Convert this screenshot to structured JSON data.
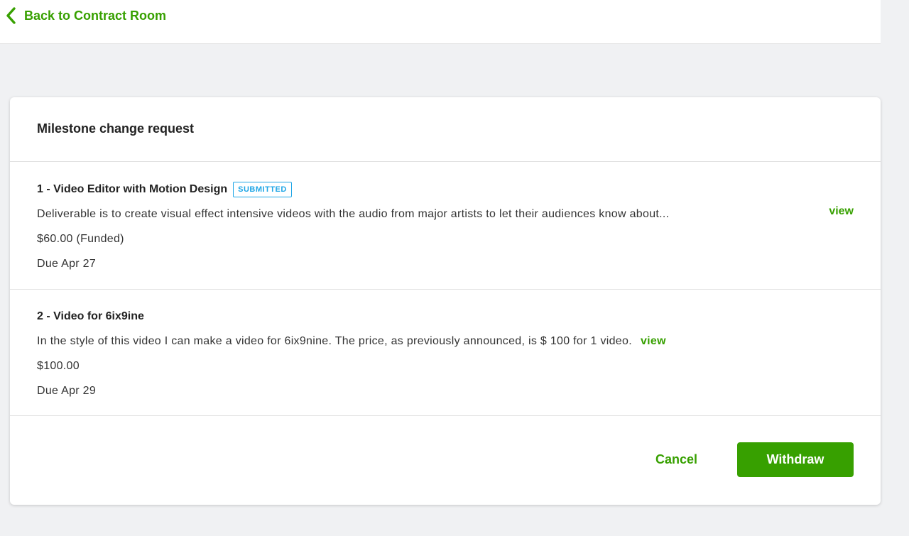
{
  "nav": {
    "back_label": "Back to Contract Room"
  },
  "card": {
    "title": "Milestone change request"
  },
  "milestones": [
    {
      "title": "1 - Video Editor with Motion Design",
      "status": "SUBMITTED",
      "description": "Deliverable is to create visual effect intensive videos with the audio from major artists to let their audiences know about...",
      "view_label": "view",
      "amount": "$60.00 (Funded)",
      "due": "Due Apr 27"
    },
    {
      "title": "2 - Video for 6ix9ine",
      "description": "In the style of this video I can make a video for 6ix9nine. The price, as previously announced, is $ 100 for 1 video.",
      "view_label": "view",
      "amount": "$100.00",
      "due": "Due Apr 29"
    }
  ],
  "actions": {
    "cancel_label": "Cancel",
    "withdraw_label": "Withdraw"
  },
  "colors": {
    "accent": "#37a000",
    "badge": "#1fa6e6",
    "background": "#f0f1f3"
  }
}
